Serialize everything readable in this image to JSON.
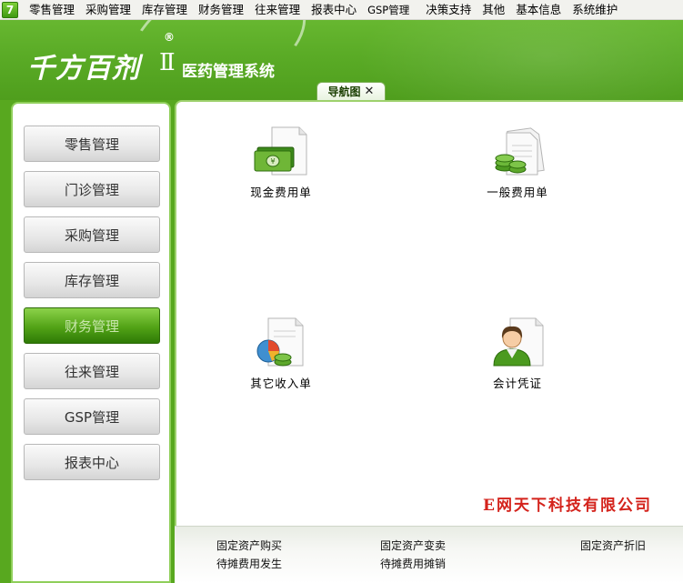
{
  "menu": {
    "app_icon": "7",
    "items": [
      "零售管理",
      "采购管理",
      "库存管理",
      "财务管理",
      "往来管理",
      "报表中心",
      "GSP管理",
      "决策支持",
      "其他",
      "基本信息",
      "系统维护"
    ]
  },
  "header": {
    "logo_text": "千方百剂",
    "logo_mark": "®",
    "version": "Ⅱ",
    "subtitle": "医药管理系统"
  },
  "tab": {
    "label": "导航图",
    "close": "✕"
  },
  "sidebar": {
    "items": [
      {
        "label": "零售管理",
        "active": false
      },
      {
        "label": "门诊管理",
        "active": false
      },
      {
        "label": "采购管理",
        "active": false
      },
      {
        "label": "库存管理",
        "active": false
      },
      {
        "label": "财务管理",
        "active": true
      },
      {
        "label": "往来管理",
        "active": false
      },
      {
        "label": "GSP管理",
        "active": false
      },
      {
        "label": "报表中心",
        "active": false
      }
    ]
  },
  "main": {
    "shortcuts": [
      {
        "label": "现金费用单",
        "icon": "cash-document-icon"
      },
      {
        "label": "一般费用单",
        "icon": "coins-document-icon"
      },
      {
        "label": "其它收入单",
        "icon": "chart-coins-document-icon"
      },
      {
        "label": "会计凭证",
        "icon": "accountant-document-icon"
      }
    ],
    "company": "E网天下科技有限公司"
  },
  "bottom_links": [
    "固定资产购买",
    "固定资产变卖",
    "固定资产折旧",
    "待摊费用发生",
    "待摊费用摊销"
  ],
  "colors": {
    "brand_green": "#58a81f",
    "active_nav": "#52a316",
    "company_red": "#d4231c"
  }
}
